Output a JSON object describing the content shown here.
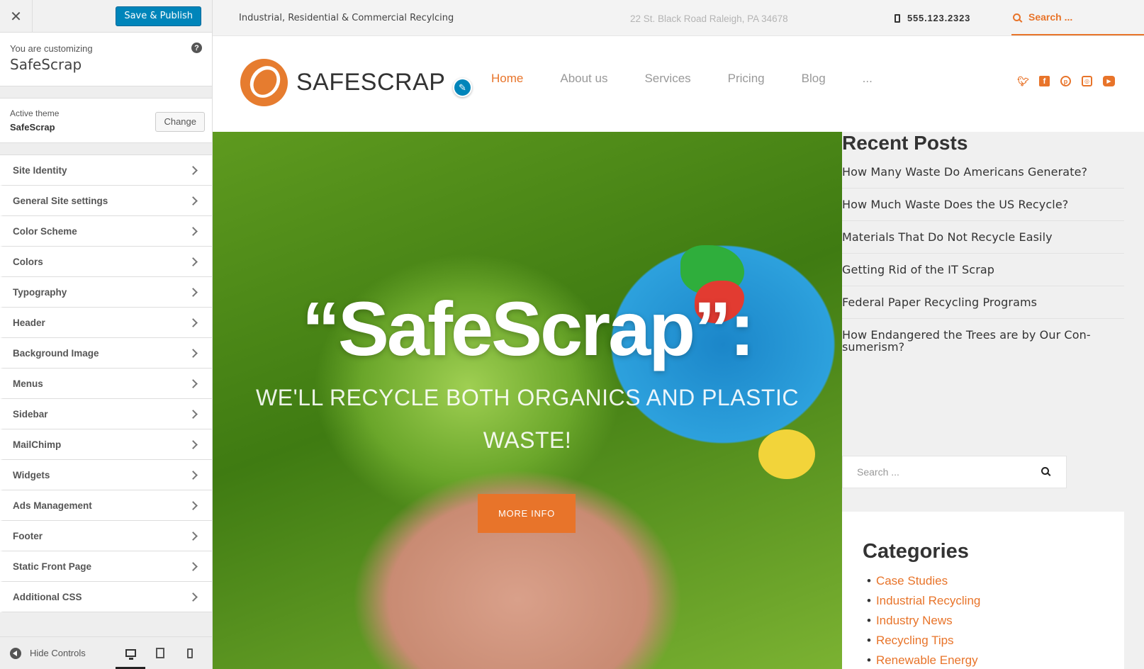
{
  "customizer": {
    "close_label": "✕",
    "save_label": "Save & Publish",
    "customizing_label": "You are customizing",
    "site_name": "SafeScrap",
    "help_icon": "?",
    "active_theme_label": "Active theme",
    "theme_name": "SafeScrap",
    "change_label": "Change",
    "sections": [
      {
        "label": "Site Identity"
      },
      {
        "label": "General Site settings"
      },
      {
        "label": "Color Scheme"
      },
      {
        "label": "Colors"
      },
      {
        "label": "Typography"
      },
      {
        "label": "Header"
      },
      {
        "label": "Background Image"
      },
      {
        "label": "Menus"
      },
      {
        "label": "Sidebar"
      },
      {
        "label": "MailChimp"
      },
      {
        "label": "Widgets"
      },
      {
        "label": "Ads Management"
      },
      {
        "label": "Footer"
      },
      {
        "label": "Static Front Page"
      },
      {
        "label": "Additional CSS"
      }
    ],
    "hide_controls_label": "Hide Controls",
    "devices": [
      "desktop-icon",
      "tablet-icon",
      "mobile-icon"
    ]
  },
  "site": {
    "tagline": "Industrial, Residential & Commercial Recylcing",
    "address": "22 St. Black Road Raleigh, PA 34678",
    "phone": "555.123.2323",
    "search_placeholder": "Search ...",
    "logo_text": "SAFESCRAP",
    "menu": [
      {
        "label": "Home",
        "active": true
      },
      {
        "label": "About us"
      },
      {
        "label": "Services"
      },
      {
        "label": "Pricing"
      },
      {
        "label": "Blog"
      },
      {
        "label": "..."
      }
    ],
    "social": [
      "twitter-icon",
      "facebook-icon",
      "pinterest-icon",
      "instagram-icon",
      "youtube-icon"
    ],
    "hero": {
      "title": "“SafeScrap”:",
      "subtitle": "WE'LL RECYCLE BOTH ORGANICS AND PLASTIC WASTE!",
      "button": "MORE INFO"
    },
    "sidebar": {
      "recent_posts_title": "Recent Posts",
      "posts": [
        "How Many Waste Do Americans Generate?",
        "How Much Waste Does the US Recycle?",
        "Materials That Do Not Recycle Easily",
        "Getting Rid of the IT Scrap",
        "Federal Paper Recycling Programs",
        "How Endangered the Trees are by Our Con-sumerism?"
      ],
      "search_placeholder": "Search ...",
      "categories_title": "Categories",
      "categories": [
        "Case Studies",
        "Industrial Recycling",
        "Industry News",
        "Recycling Tips",
        "Renewable Energy"
      ]
    }
  },
  "colors": {
    "accent": "#e8742a",
    "wp_blue": "#0085ba"
  }
}
